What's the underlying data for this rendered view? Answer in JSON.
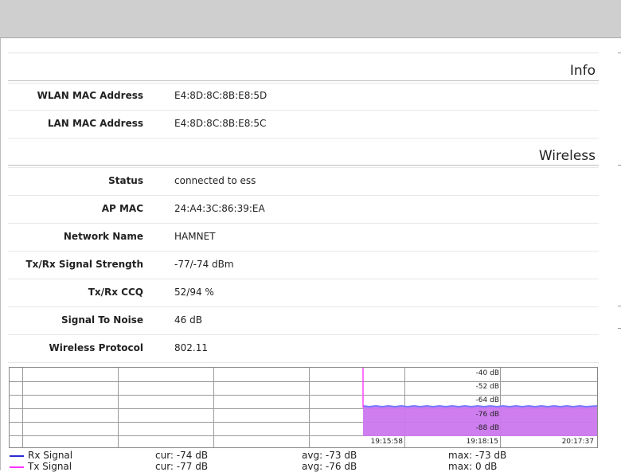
{
  "info": {
    "title": "Info",
    "rows": [
      {
        "label": "WLAN MAC Address",
        "value": "E4:8D:8C:8B:E8:5D"
      },
      {
        "label": "LAN MAC Address",
        "value": "E4:8D:8C:8B:E8:5C"
      }
    ]
  },
  "wireless": {
    "title": "Wireless",
    "rows": [
      {
        "label": "Status",
        "value": "connected to ess"
      },
      {
        "label": "AP MAC",
        "value": "24:A4:3C:86:39:EA"
      },
      {
        "label": "Network Name",
        "value": "HAMNET"
      },
      {
        "label": "Tx/Rx Signal Strength",
        "value": "-77/-74 dBm"
      },
      {
        "label": "Tx/Rx CCQ",
        "value": "52/94 %"
      },
      {
        "label": "Signal To Noise",
        "value": "46 dB"
      },
      {
        "label": "Wireless Protocol",
        "value": "802.11"
      }
    ]
  },
  "graph": {
    "y_labels": [
      "-40 dB",
      "-52 dB",
      "-64 dB",
      "-76 dB",
      "-88 dB"
    ],
    "x_labels": [
      "19:15:58",
      "19:18:15",
      "20:17:37"
    ],
    "fill_color": "#cc77ee",
    "rx_color": "#7777ff",
    "tx_color": "#ff44ff"
  },
  "legend": [
    {
      "name": "Rx Signal",
      "color": "#2a2ad4",
      "cur": "cur: -74 dB",
      "avg": "avg: -73 dB",
      "max": "max: -73 dB"
    },
    {
      "name": "Tx Signal",
      "color": "#ff33ff",
      "cur": "cur: -77 dB",
      "avg": "avg: -76 dB",
      "max": "max: 0 dB"
    }
  ]
}
